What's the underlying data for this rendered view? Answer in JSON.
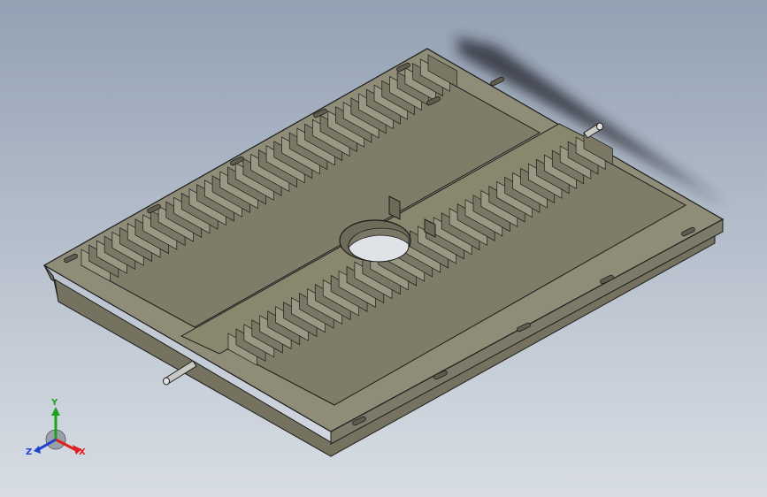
{
  "view": {
    "background_top": "#93a1b4",
    "background_bottom": "#d8dde4",
    "model_color": "#8f8c78",
    "edge_color": "#1c1c1c"
  },
  "triad": {
    "x_label": "X",
    "y_label": "Y",
    "z_label": "Z",
    "x_color": "#e02020",
    "y_color": "#1fa01f",
    "z_color": "#2040d0"
  }
}
